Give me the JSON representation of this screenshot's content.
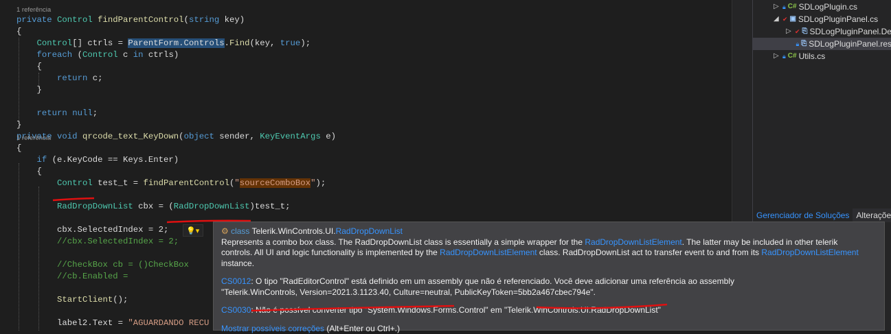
{
  "editor": {
    "codelens": [
      {
        "text": "1 referência",
        "line": 0
      },
      {
        "text": "1 referência",
        "line": 11
      }
    ],
    "lines": [
      [
        [
          "private ",
          "kw"
        ],
        [
          "Control ",
          "ty"
        ],
        [
          "findParentControl",
          "me"
        ],
        [
          "(",
          ""
        ],
        [
          "string ",
          "kw"
        ],
        [
          "key)",
          ""
        ]
      ],
      [
        [
          "{",
          ""
        ]
      ],
      [
        [
          "    ",
          ""
        ],
        [
          "Control",
          "ty"
        ],
        [
          "[] ctrls = ",
          ""
        ],
        [
          "ParentForm",
          "sel"
        ],
        [
          ".Controls",
          "sel"
        ],
        [
          ".",
          ""
        ],
        [
          "Find",
          "me"
        ],
        [
          "(key, ",
          ""
        ],
        [
          "true",
          "kw"
        ],
        [
          ");",
          ""
        ]
      ],
      [
        [
          "    ",
          ""
        ],
        [
          "foreach ",
          "kw"
        ],
        [
          "(",
          ""
        ],
        [
          "Control ",
          "ty"
        ],
        [
          "c ",
          ""
        ],
        [
          "in ",
          "kw"
        ],
        [
          "ctrls)",
          ""
        ]
      ],
      [
        [
          "    {",
          ""
        ]
      ],
      [
        [
          "        ",
          ""
        ],
        [
          "return ",
          "kw"
        ],
        [
          "c;",
          ""
        ]
      ],
      [
        [
          "    }",
          ""
        ]
      ],
      [
        [
          "",
          ""
        ]
      ],
      [
        [
          "    ",
          ""
        ],
        [
          "return ",
          "kw"
        ],
        [
          "null",
          "kw"
        ],
        [
          ";",
          ""
        ]
      ],
      [
        [
          "}",
          ""
        ]
      ],
      [
        [
          "private ",
          "kw"
        ],
        [
          "void ",
          "kw"
        ],
        [
          "qrcode_text_KeyDown",
          "me"
        ],
        [
          "(",
          ""
        ],
        [
          "object ",
          "kw"
        ],
        [
          "sender, ",
          ""
        ],
        [
          "KeyEventArgs ",
          "ty"
        ],
        [
          "e)",
          ""
        ]
      ],
      [
        [
          "{",
          ""
        ]
      ],
      [
        [
          "    ",
          ""
        ],
        [
          "if ",
          "kw"
        ],
        [
          "(e.KeyCode == Keys.Enter)",
          ""
        ]
      ],
      [
        [
          "    {",
          ""
        ]
      ],
      [
        [
          "        ",
          ""
        ],
        [
          "Control ",
          "ty"
        ],
        [
          "test_t = ",
          ""
        ],
        [
          "findParentControl",
          "me"
        ],
        [
          "(",
          ""
        ],
        [
          "\"",
          "st"
        ],
        [
          "sourceComboBox",
          "st hl"
        ],
        [
          "\"",
          "st"
        ],
        [
          ");",
          ""
        ]
      ],
      [
        [
          "",
          ""
        ]
      ],
      [
        [
          "        ",
          ""
        ],
        [
          "RadDropDownList ",
          "ty"
        ],
        [
          "cbx = (",
          ""
        ],
        [
          "RadDropDownList",
          "ty"
        ],
        [
          ")test_t;",
          ""
        ]
      ],
      [
        [
          "",
          ""
        ]
      ],
      [
        [
          "        cbx.SelectedIndex = 2;",
          ""
        ]
      ],
      [
        [
          "        ",
          ""
        ],
        [
          "//cbx.SelectedIndex = 2;",
          "cm"
        ]
      ],
      [
        [
          "",
          ""
        ]
      ],
      [
        [
          "        ",
          ""
        ],
        [
          "//CheckBox cb = ()CheckBox",
          "cm"
        ]
      ],
      [
        [
          "        ",
          ""
        ],
        [
          "//cb.Enabled =",
          "cm"
        ]
      ],
      [
        [
          "",
          ""
        ]
      ],
      [
        [
          "        ",
          ""
        ],
        [
          "StartClient",
          "me"
        ],
        [
          "();",
          ""
        ]
      ],
      [
        [
          "",
          ""
        ]
      ],
      [
        [
          "        label2.Text = ",
          ""
        ],
        [
          "\"AGUARDANDO RECU",
          "st"
        ]
      ]
    ]
  },
  "explorer": {
    "items": [
      {
        "label": "SDLogPlugin.cs",
        "icon": "csharp-file-icon",
        "glyph": "C#",
        "expander": "▷",
        "status": "lock"
      },
      {
        "label": "SDLogPluginPanel.cs",
        "icon": "form-file-icon",
        "glyph": "▣",
        "expander": "◢",
        "status": "check"
      },
      {
        "label": "SDLogPluginPanel.De",
        "icon": "designer-file-icon",
        "glyph": "⎘",
        "expander": "▷",
        "status": "check"
      },
      {
        "label": "SDLogPluginPanel.res",
        "icon": "resource-file-icon",
        "glyph": "⎘",
        "expander": "",
        "status": "lock"
      },
      {
        "label": "Utils.cs",
        "icon": "csharp-file-icon",
        "glyph": "C#",
        "expander": "▷",
        "status": "lock"
      }
    ],
    "tabs": [
      "Gerenciador de Soluções",
      "Alterações"
    ]
  },
  "tooltip": {
    "kind": "class",
    "ns": "Telerik.WinControls.UI.",
    "cls": "RadDropDownList",
    "desc1": "Represents a combo box class. The RadDropDownList class is essentially a simple wrapper for the ",
    "link": "RadDropDownListElement",
    "desc2": ". The latter may be included in other telerik controls. All UI and logic functionality is implemented by the ",
    "desc3": " class. RadDropDownList act to transfer event to and from its ",
    "desc4": " instance.",
    "err1_code": "CS0012",
    "err1_text": ": O tipo \"RadEditorControl\" está definido em um assembly que não é referenciado. Você deve adicionar uma referência ao assembly \"Telerik.WinControls, Version=2021.3.1123.40, Culture=neutral, PublicKeyToken=5bb2a467cbec794e\".",
    "err2_code": "CS0030",
    "err2_text": ": Não é possível converter tipo \"System.Windows.Forms.Control\" em \"Telerik.WinControls.UI.RadDropDownList\"",
    "fix_link": "Mostrar possíveis correções",
    "fix_hint": " (Alt+Enter ou Ctrl+.)"
  },
  "colors": {
    "keyword": "#569cd6",
    "type": "#4ec9b0",
    "method": "#dcdcaa",
    "string": "#d69d85",
    "comment": "#57a64a",
    "link": "#3794ff",
    "annotation": "#e01010"
  }
}
